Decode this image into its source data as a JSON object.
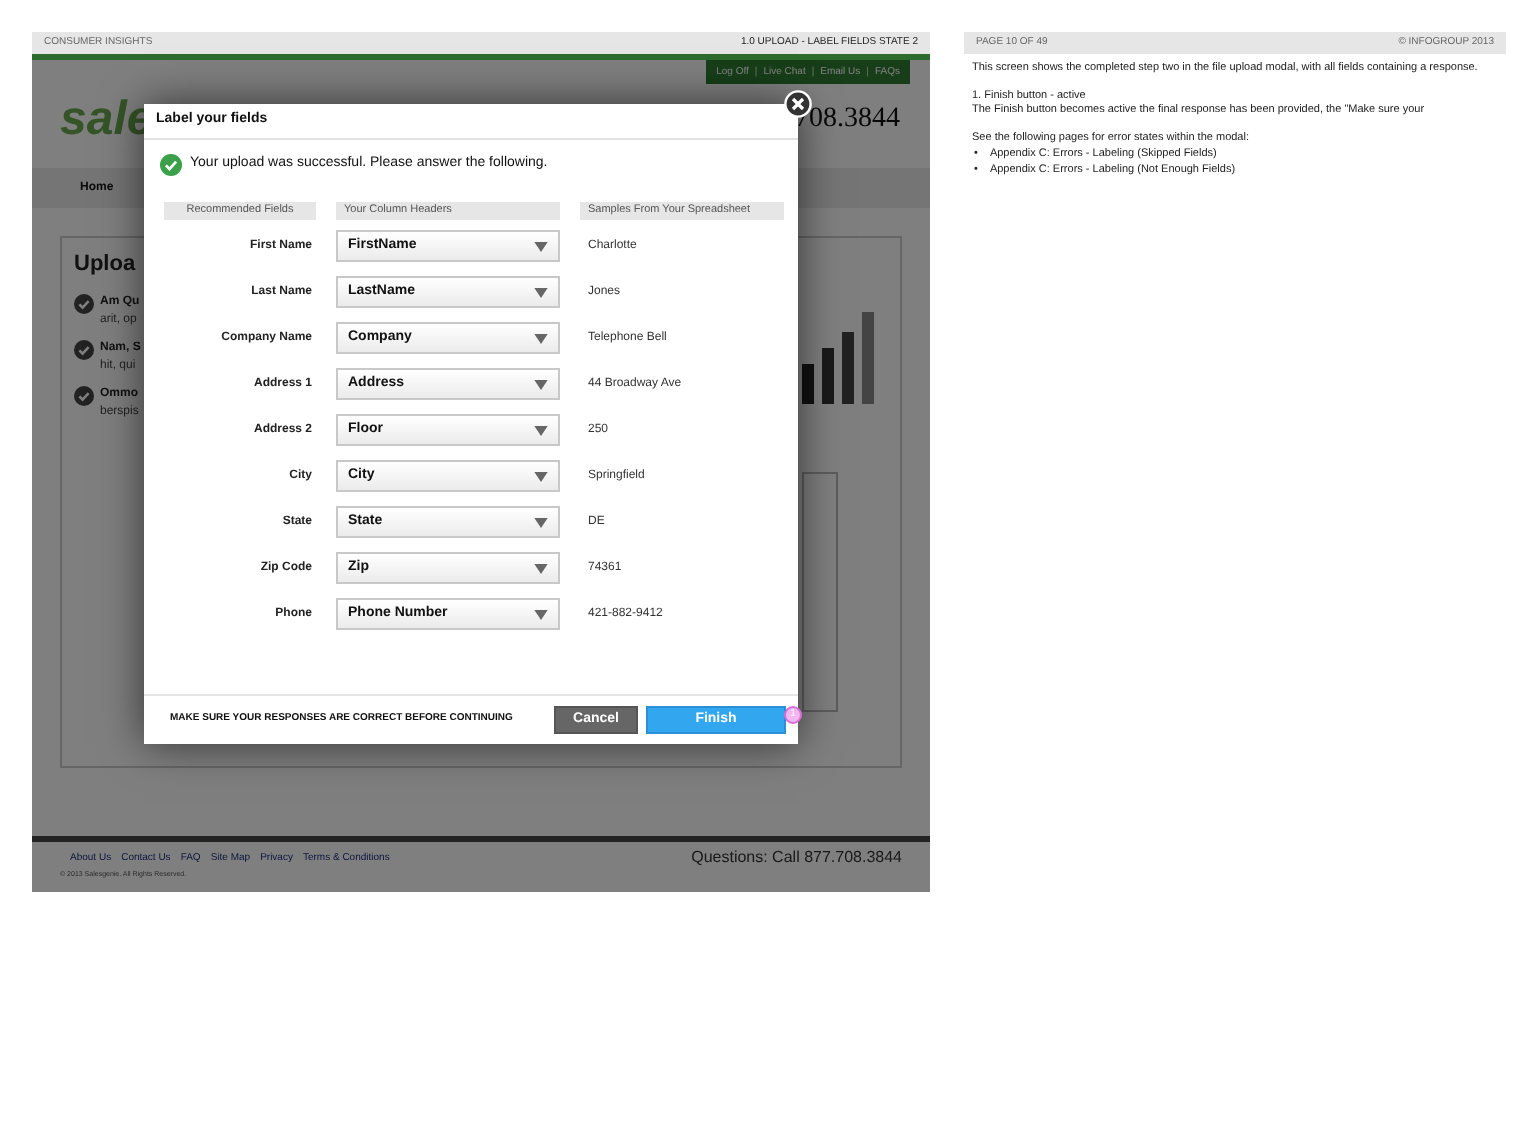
{
  "header": {
    "left": "CONSUMER INSIGHTS",
    "right": "1.0 UPLOAD - LABEL FIELDS STATE 2"
  },
  "background_page": {
    "utility_links": [
      "Log Off",
      "Live Chat",
      "Email Us",
      "FAQs"
    ],
    "separator": "|",
    "logo": "sale",
    "phone": "708.3844",
    "nav": [
      "Home"
    ],
    "panel_title": "Uploa",
    "items": [
      {
        "title": "Am Qu",
        "text": "arit, op"
      },
      {
        "title": "Nam, S",
        "text": "hit, qui"
      },
      {
        "title": "Ommo",
        "text": "berspis"
      }
    ],
    "footer_links": [
      "About Us",
      "Contact Us",
      "FAQ",
      "Site Map",
      "Privacy",
      "Terms & Conditions"
    ],
    "footer_phone": "Questions: Call 877.708.3844",
    "copyright": "© 2013 Salesgenie. All Rights Reserved."
  },
  "modal": {
    "title": "Label your fields",
    "message": "Your upload was successful. Please answer the following.",
    "columns": [
      "Recommended Fields",
      "Your Column Headers",
      "Samples From Your Spreadsheet"
    ],
    "rows": [
      {
        "field": "First Name",
        "value": "FirstName",
        "sample": "Charlotte"
      },
      {
        "field": "Last Name",
        "value": "LastName",
        "sample": "Jones"
      },
      {
        "field": "Company Name",
        "value": "Company",
        "sample": "Telephone Bell"
      },
      {
        "field": "Address 1",
        "value": "Address",
        "sample": "44 Broadway Ave"
      },
      {
        "field": "Address 2",
        "value": "Floor",
        "sample": "250"
      },
      {
        "field": "City",
        "value": "City",
        "sample": "Springfield"
      },
      {
        "field": "State",
        "value": "State",
        "sample": "DE"
      },
      {
        "field": "Zip Code",
        "value": "Zip",
        "sample": "74361"
      },
      {
        "field": "Phone",
        "value": "Phone Number",
        "sample": "421-882-9412"
      }
    ],
    "footer_note": "MAKE SURE YOUR RESPONSES ARE CORRECT BEFORE CONTINUING",
    "buttons": [
      {
        "label": "Cancel",
        "kind": "secondary"
      },
      {
        "label": "Finish",
        "kind": "primary"
      }
    ],
    "annotation": "1"
  },
  "notes": {
    "page": "PAGE 10 OF 49",
    "copyright": "© INFOGROUP 2013",
    "paragraphs": [
      "This screen shows the completed step two in the file upload modal, with all fields containing a response.",
      "1. Finish button - active",
      "The Finish button becomes active the final response has been provided, the \"Make sure your",
      "See the following pages for error states within the modal:"
    ],
    "bullet": "•",
    "list": [
      "Appendix C: Errors - Labeling (Skipped Fields)",
      "Appendix C: Errors - Labeling (Not Enough Fields)"
    ]
  }
}
